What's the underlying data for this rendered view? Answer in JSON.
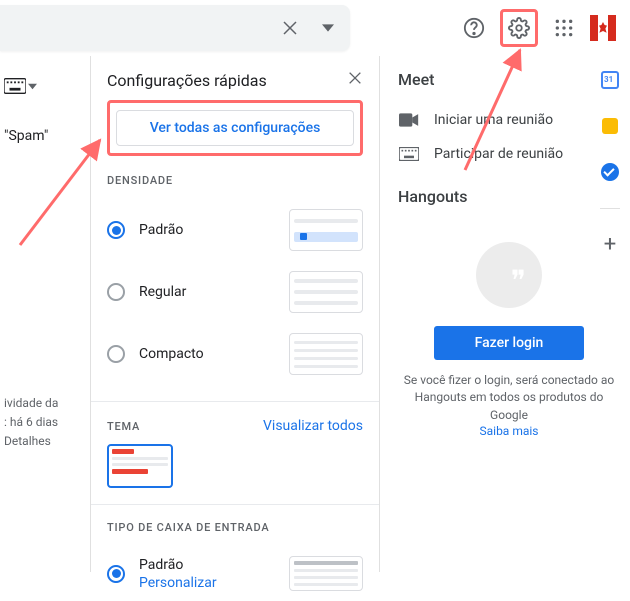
{
  "sidebar": {
    "spam_label": "\"Spam\"",
    "activity_l1": "ividade da",
    "activity_l2": ": há 6 dias",
    "activity_l3": "Detalhes"
  },
  "quick_settings": {
    "title": "Configurações rápidas",
    "see_all": "Ver todas as configurações",
    "density_header": "DENSIDADE",
    "density_options": [
      {
        "label": "Padrão",
        "selected": true
      },
      {
        "label": "Regular",
        "selected": false
      },
      {
        "label": "Compacto",
        "selected": false
      }
    ],
    "theme_header": "TEMA",
    "view_all": "Visualizar todos",
    "inbox_header": "TIPO DE CAIXA DE ENTRADA",
    "inbox_option": {
      "label": "Padrão",
      "customize": "Personalizar"
    }
  },
  "right": {
    "meet_header": "Meet",
    "meet_new": "Iniciar uma reunião",
    "meet_join": "Participar de reunião",
    "hangouts_header": "Hangouts",
    "login_btn": "Fazer login",
    "login_msg": "Se você fizer o login, será conectado ao Hangouts em todos os produtos do Google",
    "learn_more": "Saiba mais"
  },
  "siderail": {
    "cal": "31"
  }
}
